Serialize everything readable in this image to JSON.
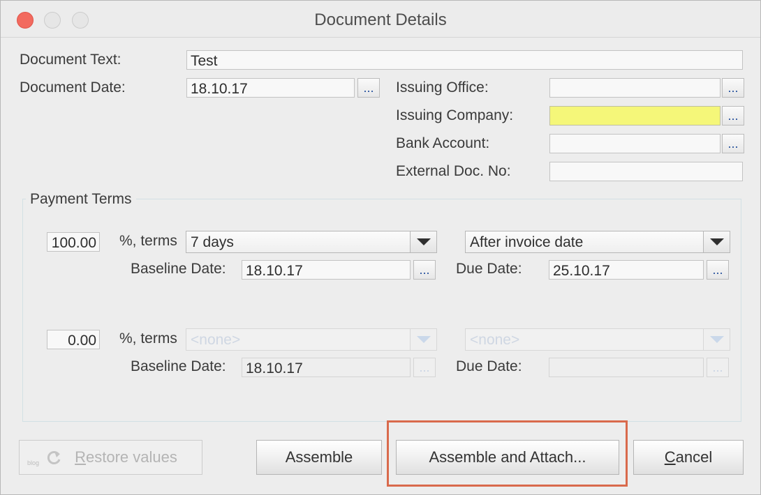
{
  "window": {
    "title": "Document Details"
  },
  "form": {
    "document_text": {
      "label": "Document Text:",
      "value": "Test"
    },
    "document_date": {
      "label": "Document Date:",
      "value": "18.10.17",
      "picker": "..."
    },
    "issuing_office": {
      "label": "Issuing Office:",
      "value": "",
      "picker": "..."
    },
    "issuing_company": {
      "label": "Issuing Company:",
      "value": "",
      "picker": "...",
      "highlight_color": "#f5f779"
    },
    "bank_account": {
      "label": "Bank Account:",
      "value": "",
      "picker": "..."
    },
    "external_doc_no": {
      "label": "External Doc. No:",
      "value": ""
    }
  },
  "payment_terms": {
    "title": "Payment Terms",
    "rows": [
      {
        "percent": "100.00",
        "terms_label": "%, terms",
        "terms_value": "7 days",
        "basis_value": "After invoice date",
        "baseline_label": "Baseline Date:",
        "baseline_value": "18.10.17",
        "due_label": "Due Date:",
        "due_value": "25.10.17",
        "picker": "...",
        "enabled": true
      },
      {
        "percent": "0.00",
        "terms_label": "%, terms",
        "terms_value": "<none>",
        "basis_value": "<none>",
        "baseline_label": "Baseline Date:",
        "baseline_value": "18.10.17",
        "due_label": "Due Date:",
        "due_value": "",
        "picker": "...",
        "enabled": false
      }
    ]
  },
  "buttons": {
    "restore": {
      "mnemonic": "R",
      "rest": "estore values",
      "icon": "restore-icon"
    },
    "assemble": "Assemble",
    "assemble_attach": "Assemble and Attach...",
    "cancel": {
      "mnemonic": "C",
      "rest": "ancel"
    }
  },
  "watermark": "blog",
  "colors": {
    "accent_dots": "#1f4c9a",
    "highlight_frame": "#d96a4c",
    "close_button": "#f26a5f"
  }
}
